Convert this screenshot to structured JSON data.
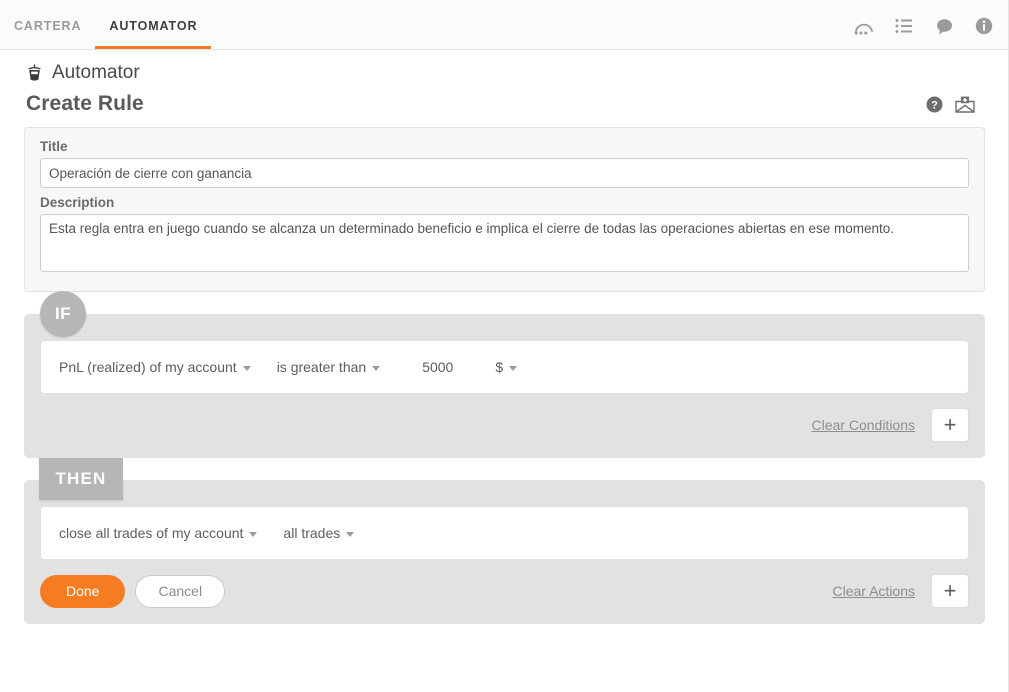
{
  "topbar": {
    "tabs": [
      {
        "label": "CARTERA",
        "active": false
      },
      {
        "label": "AUTOMATOR",
        "active": true
      }
    ],
    "icons": [
      {
        "name": "support-arc-icon",
        "glyph": "support"
      },
      {
        "name": "list-icon",
        "glyph": "list"
      },
      {
        "name": "chat-bubble-icon",
        "glyph": "chat"
      },
      {
        "name": "info-icon",
        "glyph": "info"
      }
    ],
    "accent_color": "#f57c20"
  },
  "app": {
    "title": "Automator",
    "logo_icon": "robot-icon"
  },
  "page": {
    "title": "Create Rule",
    "icons": [
      {
        "name": "help-icon",
        "glyph": "question"
      },
      {
        "name": "send-feedback-icon",
        "glyph": "envelope-plus"
      }
    ]
  },
  "meta": {
    "title_label": "Title",
    "title_value": "Operación de cierre con ganancia",
    "title_placeholder": "Title",
    "description_label": "Description",
    "description_value": "Esta regla entra en juego cuando se alcanza un determinado beneficio e implica el cierre de todas las operaciones abiertas en ese momento.",
    "description_placeholder": "Description"
  },
  "if_block": {
    "badge": "IF",
    "conditions": [
      {
        "subject": "PnL (realized) of my account",
        "operator": "is greater than",
        "value": "5000",
        "unit": "$"
      }
    ],
    "clear_label": "Clear Conditions",
    "add_label": "+"
  },
  "then_block": {
    "badge": "THEN",
    "actions": [
      {
        "action": "close all trades of my account",
        "scope": "all trades"
      }
    ],
    "clear_label": "Clear Actions",
    "add_label": "+",
    "done_label": "Done",
    "cancel_label": "Cancel",
    "done_color": "#f57c20"
  }
}
